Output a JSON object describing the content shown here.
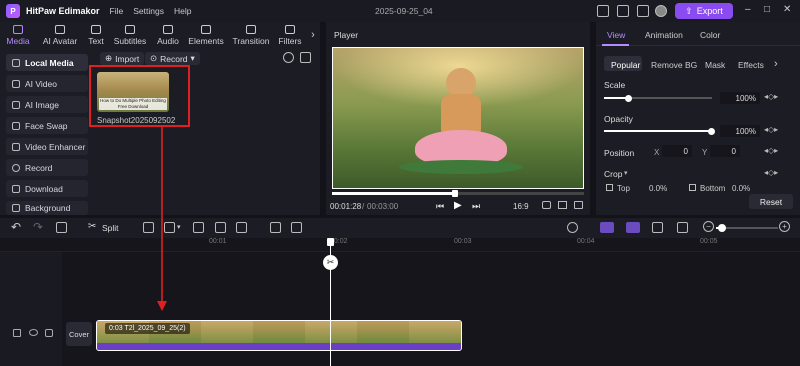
{
  "app": {
    "name": "HitPaw Edimakor",
    "menu": [
      "File",
      "Settings",
      "Help"
    ],
    "project": "2025-09-25_04",
    "export_label": "Export"
  },
  "media_tabs": [
    {
      "label": "Media",
      "active": true
    },
    {
      "label": "AI Avatar"
    },
    {
      "label": "Text"
    },
    {
      "label": "Subtitles"
    },
    {
      "label": "Audio"
    },
    {
      "label": "Elements"
    },
    {
      "label": "Transition"
    },
    {
      "label": "Filters"
    }
  ],
  "sidebar": [
    "Local Media",
    "AI Video",
    "AI Image",
    "Face Swap",
    "Video Enhancer",
    "Record",
    "Download",
    "Background"
  ],
  "media": {
    "import_label": "Import",
    "record_label": "Record",
    "thumb_label": "Snapshot2025092502",
    "thumb_caption": "How to Do Multiple Photo Editing Free Download"
  },
  "player": {
    "title": "Player",
    "current_time": "00:01:28",
    "total_time": "00:03:00",
    "ratio": "16:9",
    "progress": 0.49
  },
  "right": {
    "tabs": [
      "View",
      "Animation",
      "Color"
    ],
    "subtabs": [
      "Popular",
      "Remove BG",
      "Mask",
      "Effects"
    ],
    "scale_label": "Scale",
    "scale_value": "100%",
    "opacity_label": "Opacity",
    "opacity_value": "100%",
    "position_label": "Position",
    "x_label": "X",
    "x_value": "0",
    "y_label": "Y",
    "y_value": "0",
    "crop_label": "Crop",
    "crop_top_label": "Top",
    "crop_top_value": "0.0%",
    "crop_bottom_label": "Bottom",
    "crop_bottom_value": "0.0%",
    "reset_label": "Reset"
  },
  "toolbar": {
    "split_label": "Split"
  },
  "timeline": {
    "ticks": [
      "00:01",
      "00:02",
      "00:03",
      "00:04",
      "00:05"
    ],
    "cover_label": "Cover",
    "clip_label": "0:03  T2l_2025_09_25(2)"
  },
  "colors": {
    "accent": "#8a4cf0",
    "audio_track": "#6a3fc4",
    "highlight": "#e02020"
  }
}
